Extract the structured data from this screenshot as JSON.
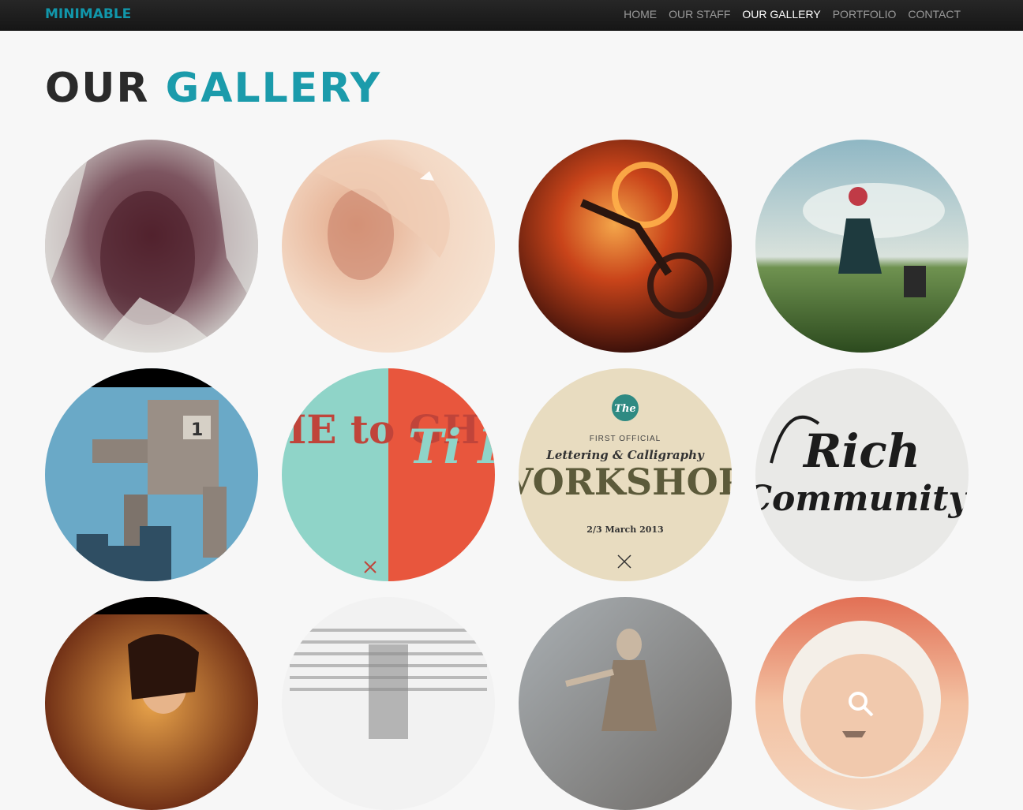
{
  "brand": {
    "name": "MINIMABLE"
  },
  "nav": {
    "items": [
      {
        "label": "HOME"
      },
      {
        "label": "OUR STAFF"
      },
      {
        "label": "OUR GALLERY"
      },
      {
        "label": "PORTFOLIO"
      },
      {
        "label": "CONTACT"
      }
    ],
    "active_index": 2
  },
  "page_title": {
    "part1": "OUR",
    "part2": "GALLERY"
  },
  "colors": {
    "accent": "#1b9bab",
    "nav_bg": "#1e1e1e",
    "page_bg": "#f7f7f7"
  },
  "gallery": {
    "items": [
      {
        "subject": "abstract portrait painting"
      },
      {
        "subject": "woman portrait with birds"
      },
      {
        "subject": "flaming bicycle rider"
      },
      {
        "subject": "woman in field with telephone"
      },
      {
        "subject": "giant robot illustration",
        "label": "1"
      },
      {
        "subject": "typography poster",
        "label_left": "IE to GHT",
        "label_right": "Ti Fi"
      },
      {
        "subject": "lettering workshop poster",
        "line1": "The",
        "line2": "FIRST OFFICIAL",
        "line3": "Lettering & Calligraphy",
        "line4": "VORKSHOP",
        "line5": "2/3 March 2013"
      },
      {
        "subject": "calligraphy logo",
        "line1": "Rich",
        "line2": "Community"
      },
      {
        "subject": "wonder woman illustration"
      },
      {
        "subject": "text typography collage"
      },
      {
        "subject": "dancer photo"
      },
      {
        "subject": "astronaut helmet with boat",
        "icon": "search-icon"
      }
    ]
  }
}
